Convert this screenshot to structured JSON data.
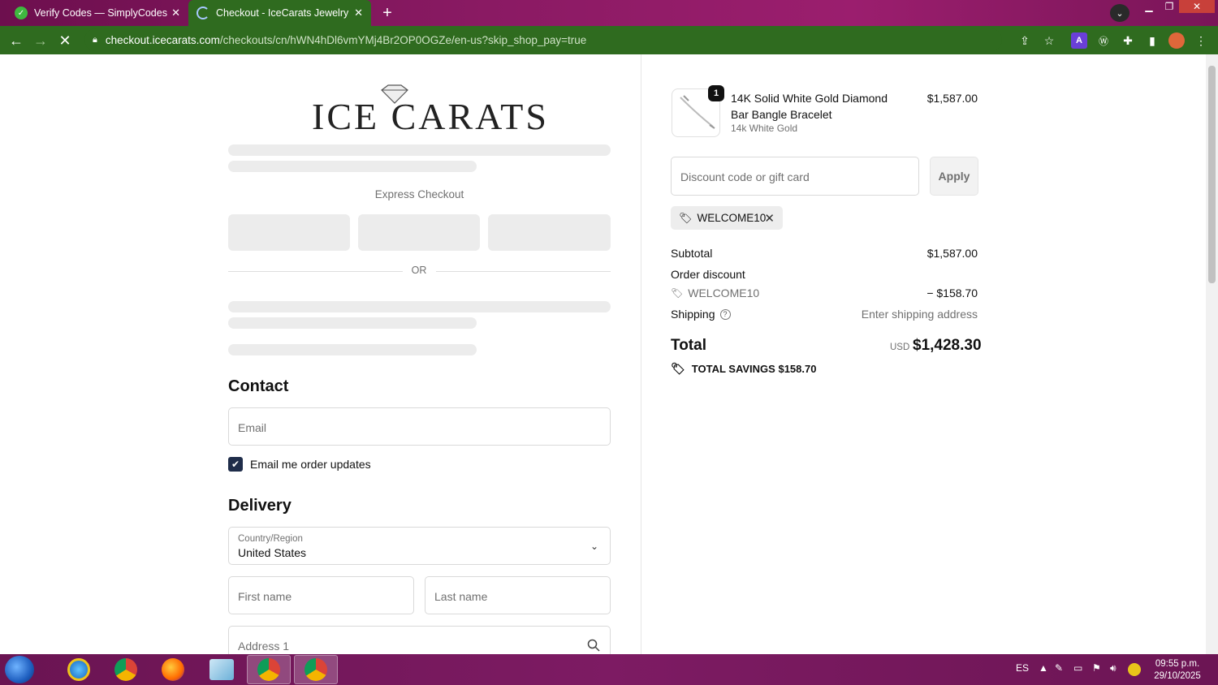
{
  "browser": {
    "tabs": [
      {
        "title": "Verify Codes — SimplyCodes",
        "active": false
      },
      {
        "title": "Checkout - IceCarats Jewelry",
        "active": true
      }
    ],
    "address": {
      "host": "checkout.icecarats.com",
      "path": "/checkouts/cn/hWN4hDl6vmYMj4Br2OP0OGZe/en-us?skip_shop_pay=true"
    }
  },
  "checkout": {
    "logo_text": "ICE CARATS",
    "express_checkout_label": "Express Checkout",
    "or_label": "OR",
    "contact": {
      "heading": "Contact",
      "email_placeholder": "Email",
      "email_updates_label": "Email me order updates",
      "email_updates_checked": true
    },
    "delivery": {
      "heading": "Delivery",
      "country_label": "Country/Region",
      "country_value": "United States",
      "first_name_placeholder": "First name",
      "last_name_placeholder": "Last name",
      "address1_placeholder": "Address 1"
    }
  },
  "summary": {
    "product": {
      "quantity": "1",
      "name": "14K Solid White Gold Diamond Bar Bangle Bracelet",
      "variant": "14k White Gold",
      "price": "$1,587.00"
    },
    "discount_placeholder": "Discount code or gift card",
    "apply_label": "Apply",
    "applied_code": "WELCOME10",
    "subtotal_label": "Subtotal",
    "subtotal_value": "$1,587.00",
    "order_discount_label": "Order discount",
    "discount_code": "WELCOME10",
    "discount_value": "− $158.70",
    "shipping_label": "Shipping",
    "shipping_value": "Enter shipping address",
    "total_label": "Total",
    "total_currency": "USD",
    "total_value": "$1,428.30",
    "savings_label": "TOTAL SAVINGS",
    "savings_value": "$158.70"
  },
  "taskbar": {
    "language": "ES",
    "time": "09:55 p.m.",
    "date": "29/10/2025"
  }
}
